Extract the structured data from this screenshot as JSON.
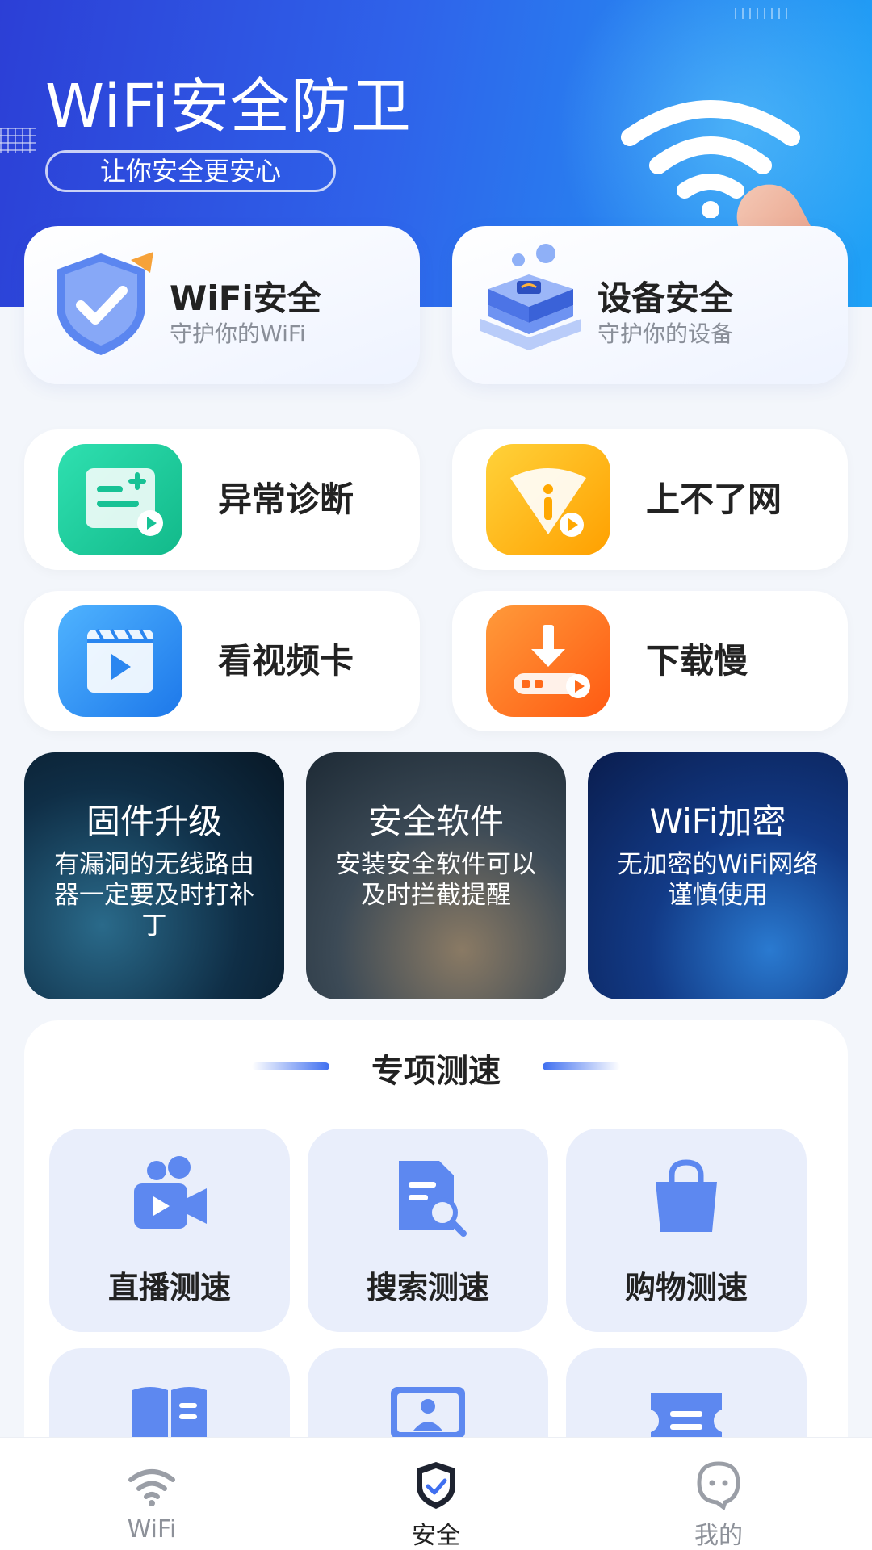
{
  "header": {
    "title": "WiFi安全防卫",
    "subtitle": "让你安全更安心"
  },
  "security_cards": [
    {
      "title": "WiFi安全",
      "subtitle": "守护你的WiFi",
      "icon": "shield-check-icon"
    },
    {
      "title": "设备安全",
      "subtitle": "守护你的设备",
      "icon": "device-chip-icon"
    }
  ],
  "features": [
    {
      "label": "异常诊断",
      "icon": "diagnosis-icon",
      "color": "#1fd1a0"
    },
    {
      "label": "上不了网",
      "icon": "network-warning-icon",
      "color": "#ffb300"
    },
    {
      "label": "看视频卡",
      "icon": "video-lag-icon",
      "color": "#2f8cf5"
    },
    {
      "label": "下载慢",
      "icon": "download-slow-icon",
      "color": "#ff6a1a"
    }
  ],
  "tips": [
    {
      "title": "固件升级",
      "body": "有漏洞的无线路由器一定要及时打补丁"
    },
    {
      "title": "安全软件",
      "body": "安装安全软件可以及时拦截提醒"
    },
    {
      "title": "WiFi加密",
      "body": "无加密的WiFi网络谨慎使用"
    }
  ],
  "speed_test": {
    "title": "专项测速",
    "items": [
      {
        "label": "直播测速",
        "icon": "live-camera-icon"
      },
      {
        "label": "搜索测速",
        "icon": "search-doc-icon"
      },
      {
        "label": "购物测速",
        "icon": "shopping-bag-icon"
      },
      {
        "label": "",
        "icon": "book-icon"
      },
      {
        "label": "",
        "icon": "online-class-icon"
      },
      {
        "label": "",
        "icon": "ticket-icon"
      }
    ]
  },
  "tabbar": {
    "items": [
      {
        "label": "WiFi",
        "icon": "wifi-icon",
        "active": false
      },
      {
        "label": "安全",
        "icon": "shield-check-icon",
        "active": true
      },
      {
        "label": "我的",
        "icon": "profile-icon",
        "active": false
      }
    ]
  },
  "colors": {
    "accent": "#3f6ff0",
    "hero_start": "#2c3fd6",
    "hero_end": "#1fa2f6"
  }
}
